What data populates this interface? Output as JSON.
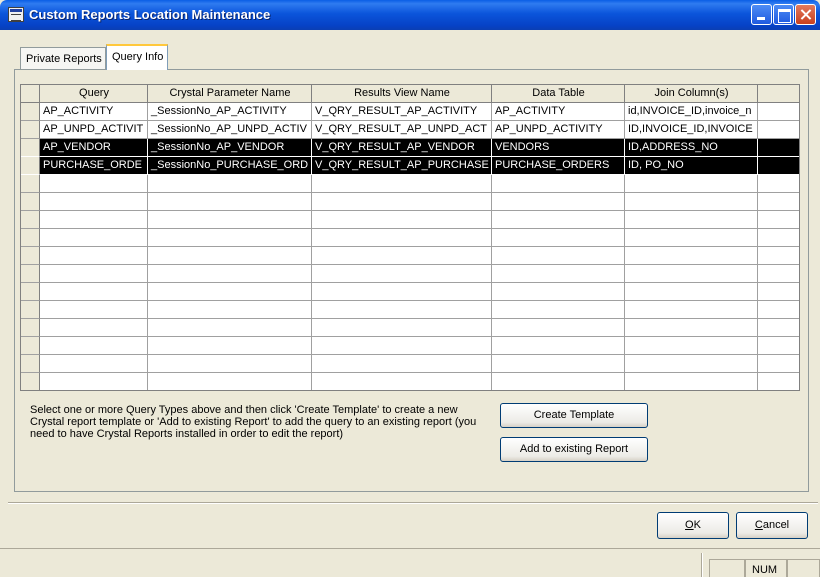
{
  "window": {
    "title": "Custom Reports Location Maintenance"
  },
  "tabs": [
    {
      "label": "Private Reports",
      "active": false
    },
    {
      "label": "Query Info",
      "active": true
    }
  ],
  "grid": {
    "columns": [
      "Query",
      "Crystal Parameter Name",
      "Results View Name",
      "Data Table",
      "Join Column(s)"
    ],
    "rows": [
      {
        "selected": false,
        "cells": [
          "AP_ACTIVITY",
          "_SessionNo_AP_ACTIVITY",
          "V_QRY_RESULT_AP_ACTIVITY",
          "AP_ACTIVITY",
          "id,INVOICE_ID,invoice_n"
        ]
      },
      {
        "selected": false,
        "cells": [
          "AP_UNPD_ACTIVIT",
          "_SessionNo_AP_UNPD_ACTIV",
          "V_QRY_RESULT_AP_UNPD_ACT",
          "AP_UNPD_ACTIVITY",
          "ID,INVOICE_ID,INVOICE"
        ]
      },
      {
        "selected": true,
        "cells": [
          "AP_VENDOR",
          "_SessionNo_AP_VENDOR",
          "V_QRY_RESULT_AP_VENDOR",
          "VENDORS",
          "ID,ADDRESS_NO"
        ]
      },
      {
        "selected": true,
        "cells": [
          "PURCHASE_ORDE",
          "_SessionNo_PURCHASE_ORD",
          "V_QRY_RESULT_AP_PURCHASE",
          "PURCHASE_ORDERS",
          "ID, PO_NO"
        ]
      }
    ]
  },
  "help_text": "Select one or more Query Types above and then click 'Create Template' to create a new Crystal report template or 'Add to existing Report' to add the query to an existing report (you need to have Crystal Reports installed in order to edit the report)",
  "buttons": {
    "create_template": "Create Template",
    "add_existing": "Add to existing Report",
    "ok_rest": "K",
    "ok_mnemonic": "O",
    "cancel_rest": "ancel",
    "cancel_mnemonic": "C"
  },
  "status": {
    "num": "NUM"
  }
}
